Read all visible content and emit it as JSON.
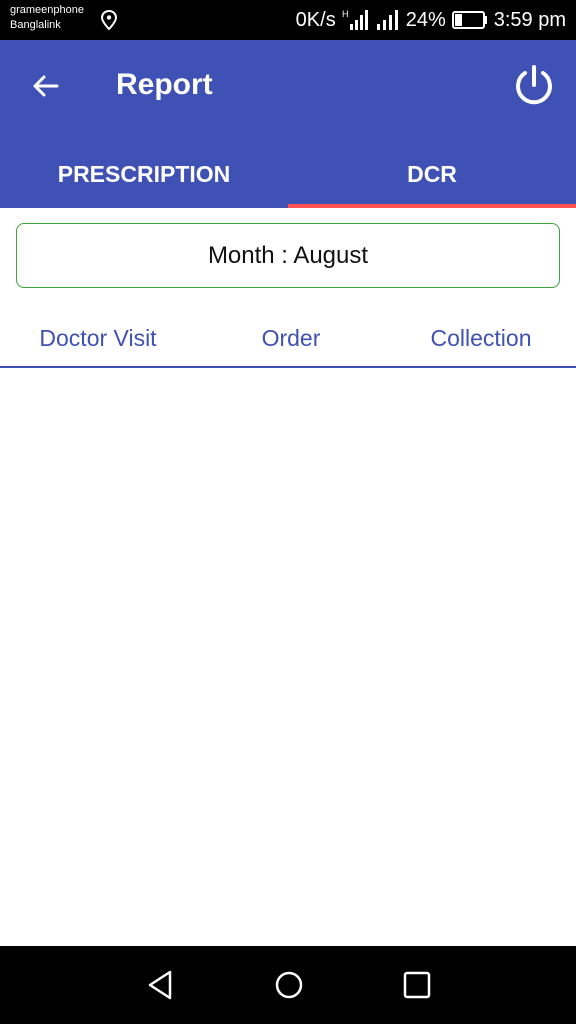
{
  "status_bar": {
    "carrier_1": "grameenphone",
    "carrier_2": "Banglalink",
    "net_speed": "0K/s",
    "network_type": "H",
    "battery": "24%",
    "time": "3:59 pm"
  },
  "app_bar": {
    "title": "Report",
    "back_icon": "arrow-left-icon",
    "power_icon": "power-icon"
  },
  "tabs": [
    {
      "label": "PRESCRIPTION",
      "active": false
    },
    {
      "label": "DCR",
      "active": true
    }
  ],
  "month_filter": {
    "label": "Month : August"
  },
  "sub_tabs": [
    {
      "label": "Doctor Visit"
    },
    {
      "label": "Order"
    },
    {
      "label": "Collection"
    }
  ],
  "colors": {
    "primary": "#3f51b5",
    "tab_indicator": "#ff5252",
    "month_border": "#3aa33a"
  },
  "nav_bar": {
    "icons": [
      "nav-back-icon",
      "nav-home-icon",
      "nav-recent-icon"
    ]
  }
}
